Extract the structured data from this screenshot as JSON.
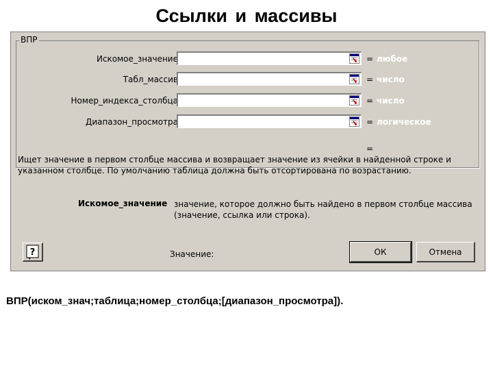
{
  "slide": {
    "title": "Ссылки  и  массивы",
    "syntax": "ВПР(иском_знач;таблица;номер_столбца;[диапазон_просмотра])."
  },
  "dialog": {
    "group_title": "ВПР",
    "args": [
      {
        "label": "Искомое_значение",
        "value": "",
        "eq": "=",
        "hint": "любое"
      },
      {
        "label": "Табл_массив",
        "value": "",
        "eq": "=",
        "hint": "число"
      },
      {
        "label": "Номер_индекса_столбца",
        "value": "",
        "eq": "=",
        "hint": "число"
      },
      {
        "label": "Диапазон_просмотра",
        "value": "",
        "eq": "=",
        "hint": "логическое"
      }
    ],
    "result_eq": "=",
    "description": "Ищет значение в первом столбце массива и возвращает значение из ячейки в найденной строке и указанном столбце. По умолчанию таблица должна быть отсортирована по возрастанию.",
    "arg_desc": {
      "name": "Искомое_значение",
      "text": "значение, которое должно быть найдено в первом столбце массива (значение, ссылка или строка)."
    },
    "value_label": "Значение:",
    "ok_label": "ОК",
    "cancel_label": "Отмена"
  },
  "icons": {
    "ref": "collapse-dialog-icon",
    "help": "help-icon"
  },
  "colors": {
    "dialog_bg": "#d4d0c8",
    "hint_text": "#ffffff"
  }
}
